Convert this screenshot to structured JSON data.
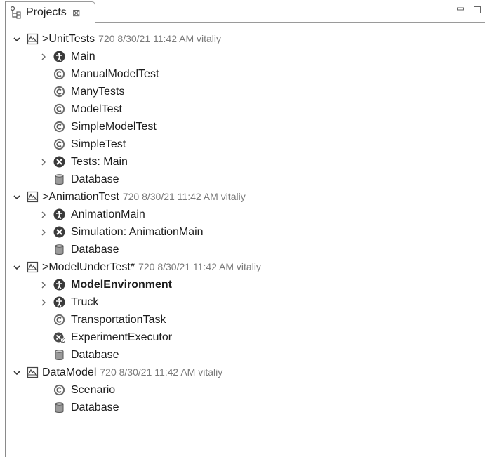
{
  "tab": {
    "title": "Projects",
    "close_glyph": "⊠"
  },
  "icons": {
    "tab": "project-tree-icon",
    "project": "model-project-icon",
    "agent": "agent-type-icon",
    "class": "java-class-icon",
    "experiment": "experiment-icon",
    "database": "database-icon",
    "custom_experiment": "custom-experiment-icon"
  },
  "colors": {
    "accent": "#4a4a4a",
    "meta": "#7a7a7a"
  },
  "tree": [
    {
      "label": ">UnitTests",
      "meta": "720 8/30/21 11:42 AM vitaliy"
    },
    {
      "label": "Main"
    },
    {
      "label": "ManualModelTest"
    },
    {
      "label": "ManyTests"
    },
    {
      "label": "ModelTest"
    },
    {
      "label": "SimpleModelTest"
    },
    {
      "label": "SimpleTest"
    },
    {
      "label": "Tests: Main"
    },
    {
      "label": "Database"
    },
    {
      "label": ">AnimationTest",
      "meta": "720 8/30/21 11:42 AM vitaliy"
    },
    {
      "label": "AnimationMain"
    },
    {
      "label": "Simulation: AnimationMain"
    },
    {
      "label": "Database"
    },
    {
      "label": ">ModelUnderTest*",
      "meta": "720 8/30/21 11:42 AM vitaliy"
    },
    {
      "label": "ModelEnvironment"
    },
    {
      "label": "Truck"
    },
    {
      "label": "TransportationTask"
    },
    {
      "label": "ExperimentExecutor"
    },
    {
      "label": "Database"
    },
    {
      "label": "DataModel",
      "meta": "720 8/30/21 11:42 AM vitaliy"
    },
    {
      "label": "Scenario"
    },
    {
      "label": "Database"
    }
  ]
}
